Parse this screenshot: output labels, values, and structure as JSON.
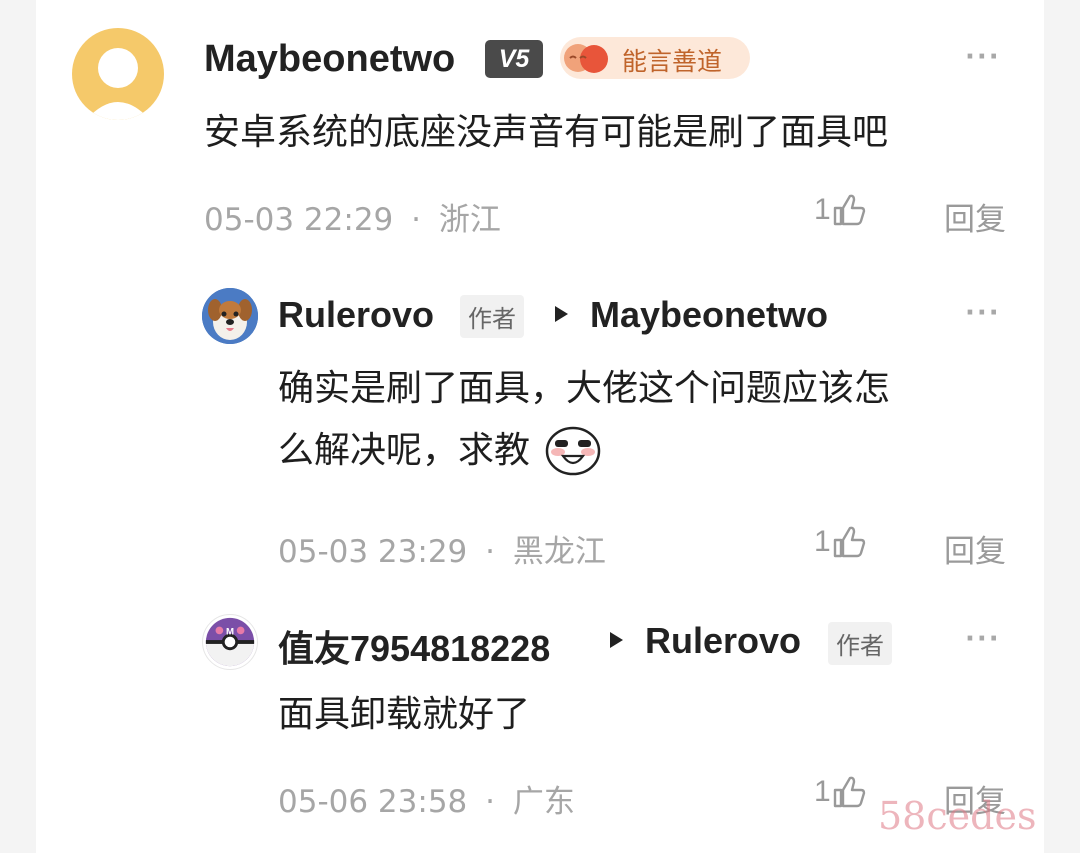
{
  "comments": [
    {
      "user": "Maybeonetwo",
      "level_badge": "V5",
      "honor_badge": "能言善道",
      "text": "安卓系统的底座没声音有可能是刷了面具吧",
      "time": "05-03 22:29",
      "location": "浙江",
      "likes": "1",
      "reply_label": "回复",
      "more": "···"
    },
    {
      "user": "Rulerovo",
      "author_tag": "作者",
      "reply_to": "Maybeonetwo",
      "text_line1": "确实是刷了面具，大佬这个问题应该怎",
      "text_line2": "么解决呢，求教",
      "time": "05-03 23:29",
      "location": "黑龙江",
      "likes": "1",
      "reply_label": "回复",
      "more": "···"
    },
    {
      "user": "值友7954818228",
      "reply_to": "Rulerovo",
      "reply_to_tag": "作者",
      "text": "面具卸载就好了",
      "time": "05-06 23:58",
      "location": "广东",
      "likes": "1",
      "reply_label": "回复",
      "more": "···"
    }
  ],
  "meta_separator": "·",
  "watermark": "58cedes",
  "colors": {
    "background": "#f4f4f4",
    "card": "#ffffff",
    "name": "#222222",
    "meta": "#a6a6a6",
    "honor_badge_text": "#c0642b",
    "honor_badge_bg": "#fde8d9",
    "level_badge_bg": "#4a4a4a",
    "watermark": "#e07a86"
  },
  "icons": [
    "default-avatar-icon",
    "dog-avatar-icon",
    "pokeball-avatar-icon",
    "thumbs-up-icon",
    "more-icon",
    "laughing-emoji-icon"
  ]
}
